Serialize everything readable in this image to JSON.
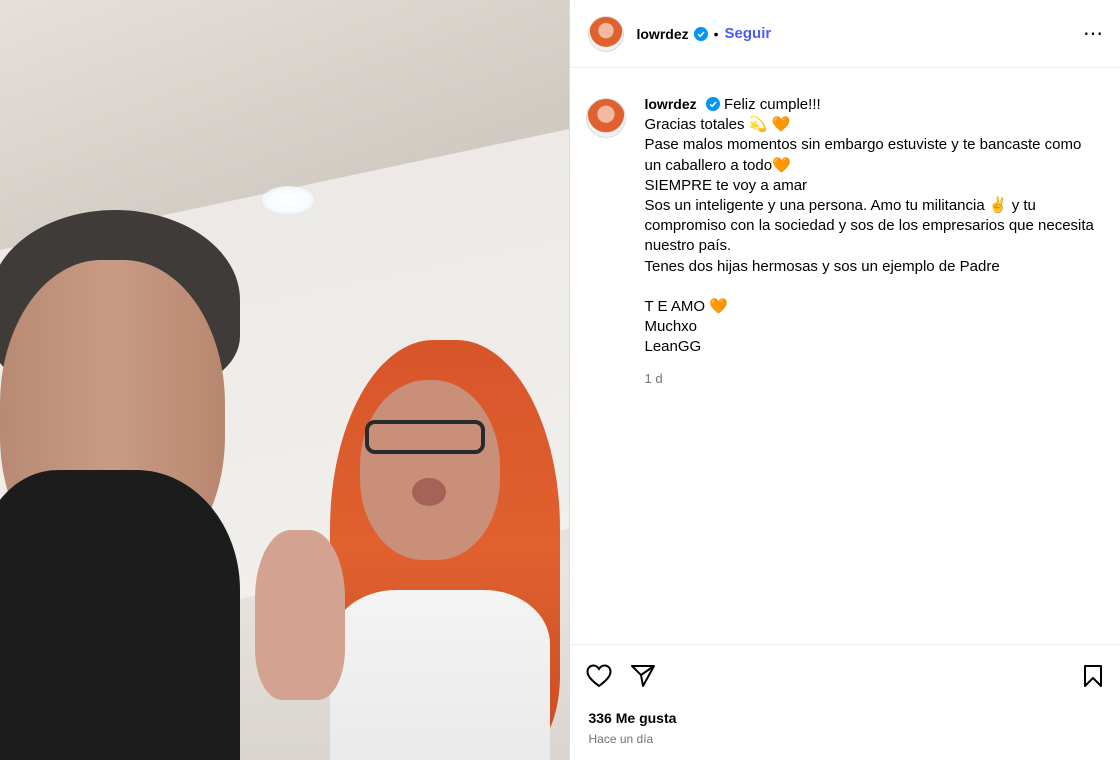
{
  "post": {
    "username": "lowrdez",
    "follow_label": "Seguir",
    "separator": "•",
    "more_label": "⋯",
    "caption": {
      "first_line": "Feliz cumple!!!",
      "lines": [
        "Gracias totales 💫 🧡",
        "Pase malos momentos sin embargo estuviste y te bancaste como",
        "un caballero a todo🧡",
        "SIEMPRE te voy a amar",
        "Sos un inteligente y una persona. Amo tu militancia ✌️  y tu",
        "compromiso con la sociedad y sos de los empresarios que necesita",
        "nuestro país.",
        "Tenes dos hijas hermosas y sos un ejemplo de Padre"
      ],
      "closing_lines": [
        "T E AMO 🧡",
        "Muchxo",
        "LeanGG"
      ],
      "time": "1 d"
    },
    "likes": "336 Me gusta",
    "posted_ago": "Hace un día"
  },
  "icons": {
    "like": "heart-icon",
    "share": "send-icon",
    "save": "bookmark-icon",
    "verified": "verified-badge-icon",
    "more": "more-options-icon"
  },
  "colors": {
    "follow": "#4a5df0",
    "verified": "#0095f6",
    "muted": "#737373"
  }
}
